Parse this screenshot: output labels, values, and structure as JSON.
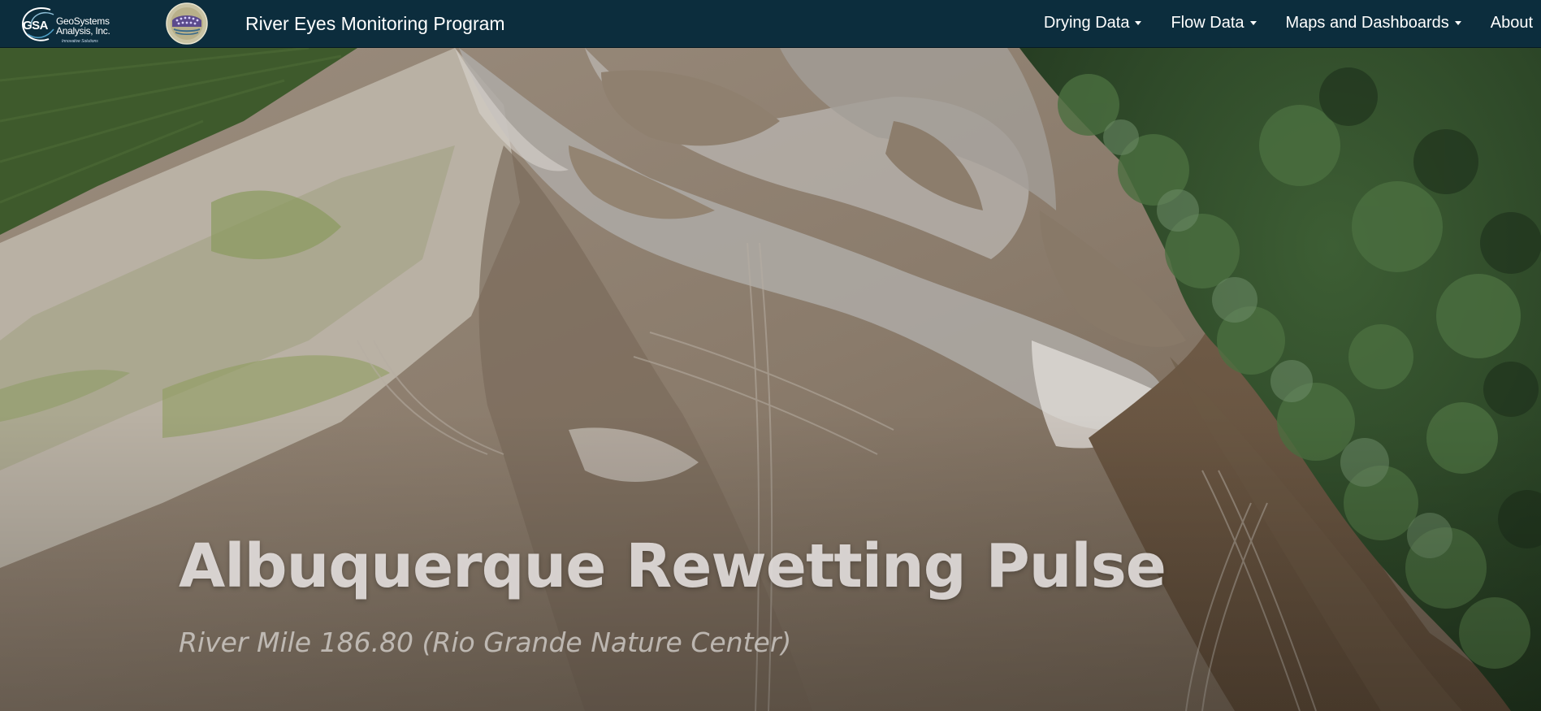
{
  "navbar": {
    "logo": {
      "abbr": "GSA",
      "name": "GeoSystems\nAnalysis, Inc.",
      "tagline": "Innovative Solutions"
    },
    "seal_icon": "program-seal-icon",
    "brand": "River Eyes Monitoring Program",
    "items": [
      {
        "label": "Drying Data",
        "dropdown": true
      },
      {
        "label": "Flow Data",
        "dropdown": true
      },
      {
        "label": "Maps and Dashboards",
        "dropdown": true
      },
      {
        "label": "About",
        "dropdown": false
      }
    ]
  },
  "hero": {
    "title": "Albuquerque Rewetting Pulse",
    "subtitle": "River Mile 186.80 (Rio Grande Nature Center)"
  },
  "colors": {
    "navbar_bg": "#0c2d3d",
    "nav_text": "#ffffff",
    "sand": "#8d7f70",
    "water": "#a9a5a3",
    "trees": "#2f4a2a",
    "river": "#6a5641"
  }
}
